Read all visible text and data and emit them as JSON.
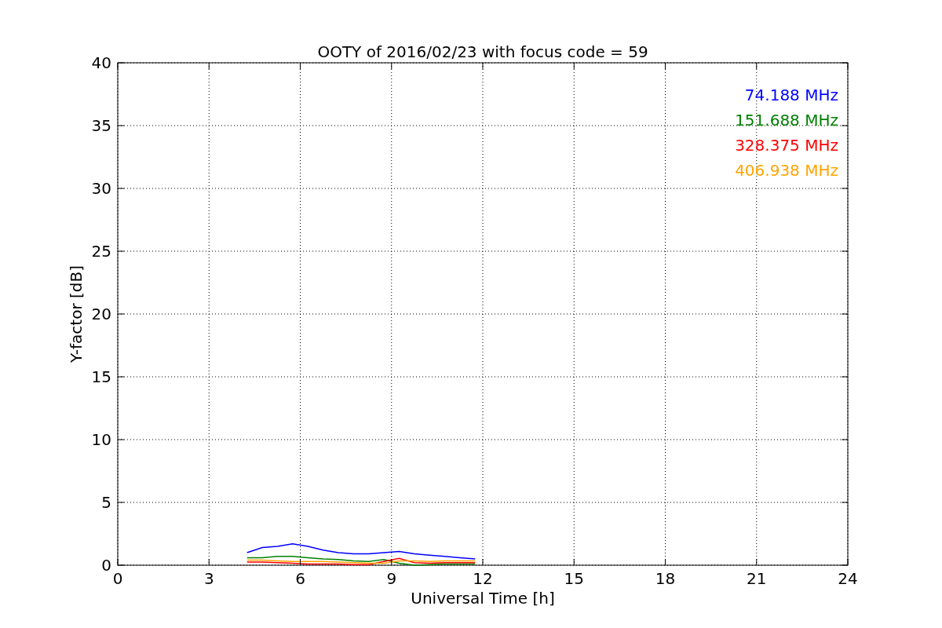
{
  "figure": {
    "chart_data": {
      "type": "line",
      "title": "OOTY of 2016/02/23 with focus code = 59",
      "xlabel": "Universal Time [h]",
      "ylabel": "Y-factor [dB]",
      "x": [
        4.25,
        4.75,
        5.25,
        5.75,
        6.25,
        6.75,
        7.25,
        7.75,
        8.25,
        8.75,
        9.25,
        9.75,
        10.25,
        10.75,
        11.25,
        11.75
      ],
      "series": [
        {
          "name": "74.188 MHz",
          "color": "#0000ff",
          "values": [
            1.0,
            1.4,
            1.5,
            1.7,
            1.5,
            1.2,
            1.0,
            0.9,
            0.9,
            1.0,
            1.1,
            0.9,
            0.8,
            0.7,
            0.6,
            0.5
          ]
        },
        {
          "name": "151.688 MHz",
          "color": "#008000",
          "values": [
            0.6,
            0.6,
            0.7,
            0.7,
            0.6,
            0.5,
            0.45,
            0.35,
            0.3,
            0.45,
            0.15,
            0.0,
            0.05,
            0.1,
            0.1,
            0.1
          ]
        },
        {
          "name": "328.375 MHz",
          "color": "#ff0000",
          "values": [
            0.25,
            0.25,
            0.2,
            0.15,
            0.1,
            0.1,
            0.1,
            0.05,
            0.05,
            0.3,
            0.55,
            0.2,
            0.15,
            0.2,
            0.2,
            0.2
          ]
        },
        {
          "name": "406.938 MHz",
          "color": "#ffa500",
          "values": [
            0.4,
            0.4,
            0.35,
            0.3,
            0.3,
            0.3,
            0.25,
            0.2,
            0.15,
            0.15,
            0.35,
            0.35,
            0.3,
            0.35,
            0.35,
            0.35
          ]
        }
      ],
      "xlim": [
        0,
        24
      ],
      "ylim": [
        0,
        40
      ],
      "xticks": [
        0,
        3,
        6,
        9,
        12,
        15,
        18,
        21,
        24
      ],
      "yticks": [
        0,
        5,
        10,
        15,
        20,
        25,
        30,
        35,
        40
      ],
      "grid": true
    }
  }
}
